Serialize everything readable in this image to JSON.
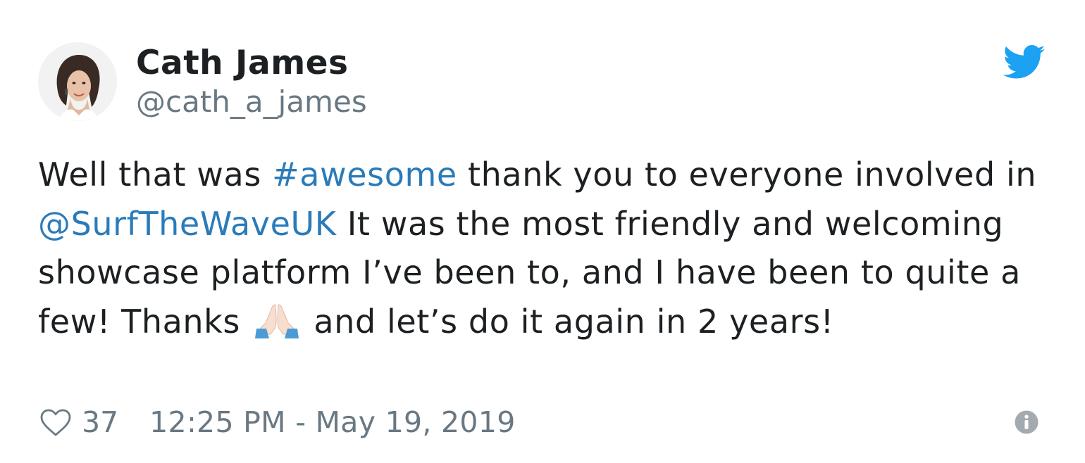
{
  "author": {
    "name": "Cath James",
    "handle": "@cath_a_james"
  },
  "tweet": {
    "segments": [
      {
        "text": "Well that was ",
        "type": "text"
      },
      {
        "text": "#awesome",
        "type": "hashtag"
      },
      {
        "text": " thank you to everyone involved in ",
        "type": "text"
      },
      {
        "text": "@SurfTheWaveUK",
        "type": "mention"
      },
      {
        "text": " It was the most friendly and welcoming showcase platform I’ve been to, and I have been to quite a few! Thanks ",
        "type": "text"
      },
      {
        "text": "",
        "type": "emoji",
        "icon": "folded-hands-emoji"
      },
      {
        "text": " and let’s do it again in 2 years!",
        "type": "text"
      }
    ]
  },
  "footer": {
    "likes": "37",
    "timestamp": "12:25 PM - May 19, 2019"
  },
  "colors": {
    "link": "#2b7bb9",
    "muted": "#697882",
    "text": "#1c2022",
    "bird": "#1da1f2",
    "info": "#a3aab0"
  },
  "icons": {
    "brand": "twitter-bird-icon",
    "like": "heart-icon",
    "info": "info-icon"
  }
}
